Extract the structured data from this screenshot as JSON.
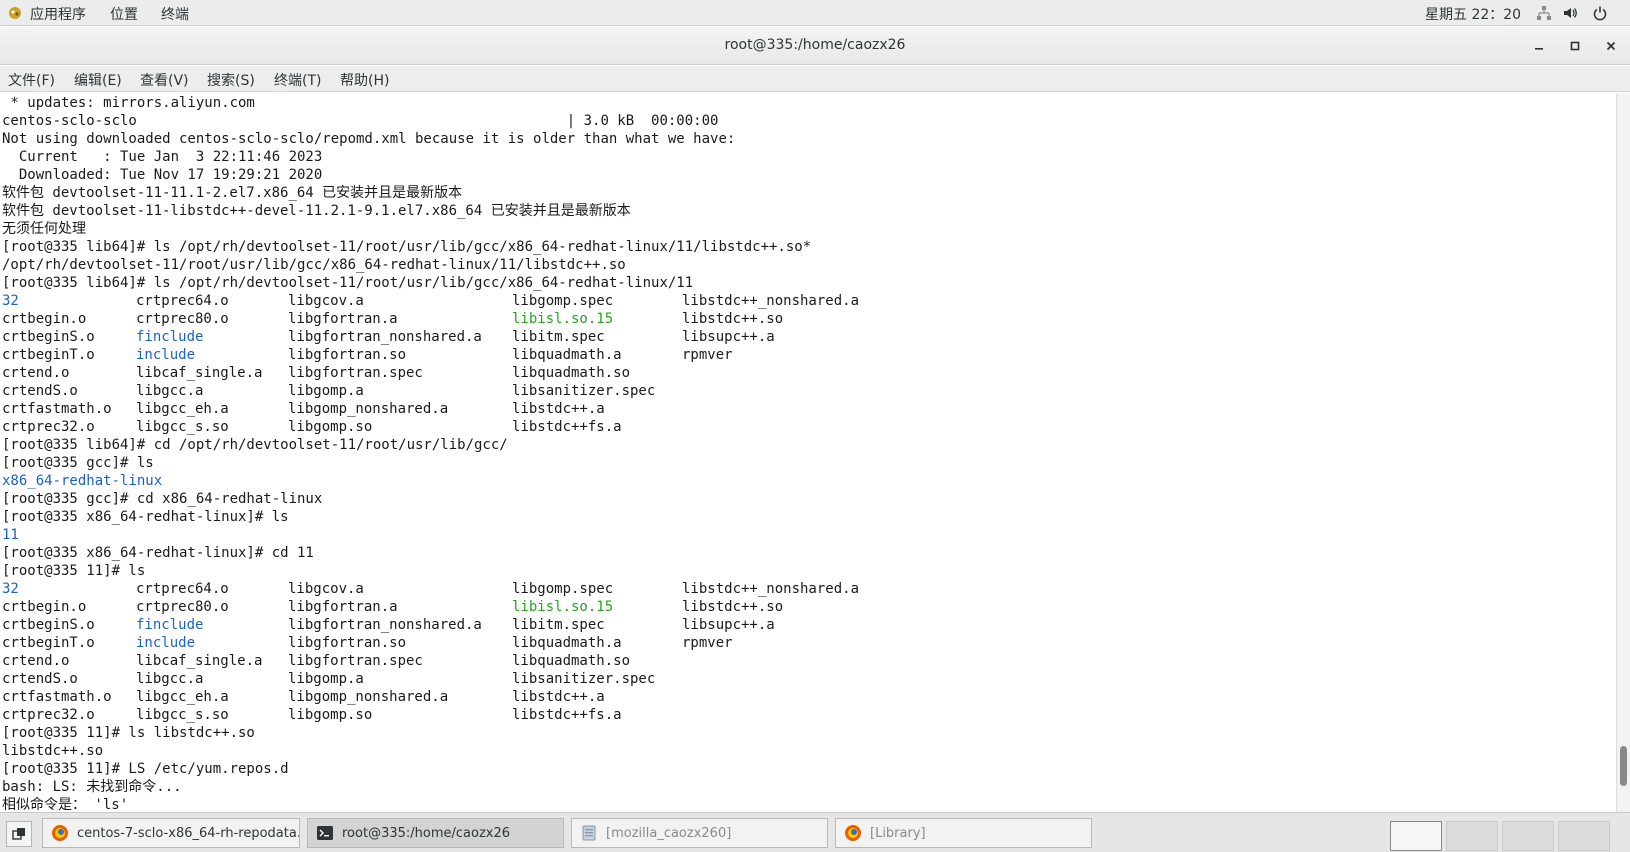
{
  "top_bar": {
    "menus": [
      "应用程序",
      "位置",
      "终端"
    ],
    "clock": "星期五 22：20",
    "icons": [
      "apps-icon",
      "network-icon",
      "volume-icon",
      "power-icon"
    ]
  },
  "window": {
    "title": "root@335:/home/caozx26",
    "buttons": [
      "minimize-icon",
      "maximize-icon",
      "close-icon"
    ]
  },
  "menubar": [
    "文件(F)",
    "编辑(E)",
    "查看(V)",
    "搜索(S)",
    "终端(T)",
    "帮助(H)"
  ],
  "terminal": {
    "lines": [
      " * updates: mirrors.aliyun.com",
      "centos-sclo-sclo                                                   | 3.0 kB  00:00:00",
      "Not using downloaded centos-sclo-sclo/repomd.xml because it is older than what we have:",
      "  Current   : Tue Jan  3 22:11:46 2023",
      "  Downloaded: Tue Nov 17 19:29:21 2020",
      "软件包 devtoolset-11-11.1-2.el7.x86_64 已安装并且是最新版本",
      "软件包 devtoolset-11-libstdc++-devel-11.2.1-9.1.el7.x86_64 已安装并且是最新版本",
      "无须任何处理",
      "[root@335 lib64]# ls /opt/rh/devtoolset-11/root/usr/lib/gcc/x86_64-redhat-linux/11/libstdc++.so*",
      "/opt/rh/devtoolset-11/root/usr/lib/gcc/x86_64-redhat-linux/11/libstdc++.so",
      "[root@335 lib64]# ls /opt/rh/devtoolset-11/root/usr/lib/gcc/x86_64-redhat-linux/11"
    ],
    "listing_1": [
      [
        "32",
        "crtprec64.o",
        "libgcov.a",
        "libgomp.spec",
        "libstdc++_nonshared.a"
      ],
      [
        "crtbegin.o",
        "crtprec80.o",
        "libgfortran.a",
        "libisl.so.15",
        "libstdc++.so"
      ],
      [
        "crtbeginS.o",
        "finclude",
        "libgfortran_nonshared.a",
        "libitm.spec",
        "libsupc++.a"
      ],
      [
        "crtbeginT.o",
        "include",
        "libgfortran.so",
        "libquadmath.a",
        "rpmver"
      ],
      [
        "crtend.o",
        "libcaf_single.a",
        "libgfortran.spec",
        "libquadmath.so",
        ""
      ],
      [
        "crtendS.o",
        "libgcc.a",
        "libgomp.a",
        "libsanitizer.spec",
        ""
      ],
      [
        "crtfastmath.o",
        "libgcc_eh.a",
        "libgomp_nonshared.a",
        "libstdc++.a",
        ""
      ],
      [
        "crtprec32.o",
        "libgcc_s.so",
        "libgomp.so",
        "libstdc++fs.a",
        ""
      ]
    ],
    "mid_lines": [
      "[root@335 lib64]# cd /opt/rh/devtoolset-11/root/usr/lib/gcc/",
      "[root@335 gcc]# ls",
      "x86_64-redhat-linux",
      "[root@335 gcc]# cd x86_64-redhat-linux",
      "[root@335 x86_64-redhat-linux]# ls",
      "11",
      "[root@335 x86_64-redhat-linux]# cd 11",
      "[root@335 11]# ls"
    ],
    "listing_2": [
      [
        "32",
        "crtprec64.o",
        "libgcov.a",
        "libgomp.spec",
        "libstdc++_nonshared.a"
      ],
      [
        "crtbegin.o",
        "crtprec80.o",
        "libgfortran.a",
        "libisl.so.15",
        "libstdc++.so"
      ],
      [
        "crtbeginS.o",
        "finclude",
        "libgfortran_nonshared.a",
        "libitm.spec",
        "libsupc++.a"
      ],
      [
        "crtbeginT.o",
        "include",
        "libgfortran.so",
        "libquadmath.a",
        "rpmver"
      ],
      [
        "crtend.o",
        "libcaf_single.a",
        "libgfortran.spec",
        "libquadmath.so",
        ""
      ],
      [
        "crtendS.o",
        "libgcc.a",
        "libgomp.a",
        "libsanitizer.spec",
        ""
      ],
      [
        "crtfastmath.o",
        "libgcc_eh.a",
        "libgomp_nonshared.a",
        "libstdc++.a",
        ""
      ],
      [
        "crtprec32.o",
        "libgcc_s.so",
        "libgomp.so",
        "libstdc++fs.a",
        ""
      ]
    ],
    "end_lines": [
      "[root@335 11]# ls libstdc++.so",
      "libstdc++.so",
      "[root@335 11]# LS /etc/yum.repos.d",
      "bash: LS: 未找到命令...",
      "相似命令是： 'ls'"
    ],
    "colors": {
      "directory": "#1a5fd6",
      "symlink": "#2aa31f",
      "text": "#1a1a1a"
    },
    "blue_entries": [
      "32",
      "finclude",
      "include",
      "x86_64-redhat-linux",
      "11"
    ],
    "green_entries": [
      "libisl.so.15"
    ]
  },
  "taskbar": {
    "tasks": [
      {
        "label": "centos-7-sclo-x86_64-rh-repodata...",
        "icon": "firefox-icon",
        "state": "normal"
      },
      {
        "label": "root@335:/home/caozx26",
        "icon": "terminal-icon",
        "state": "active"
      },
      {
        "label": "[mozilla_caozx260]",
        "icon": "file-manager-icon",
        "state": "inactive"
      },
      {
        "label": "[Library]",
        "icon": "firefox-icon",
        "state": "inactive"
      }
    ]
  }
}
